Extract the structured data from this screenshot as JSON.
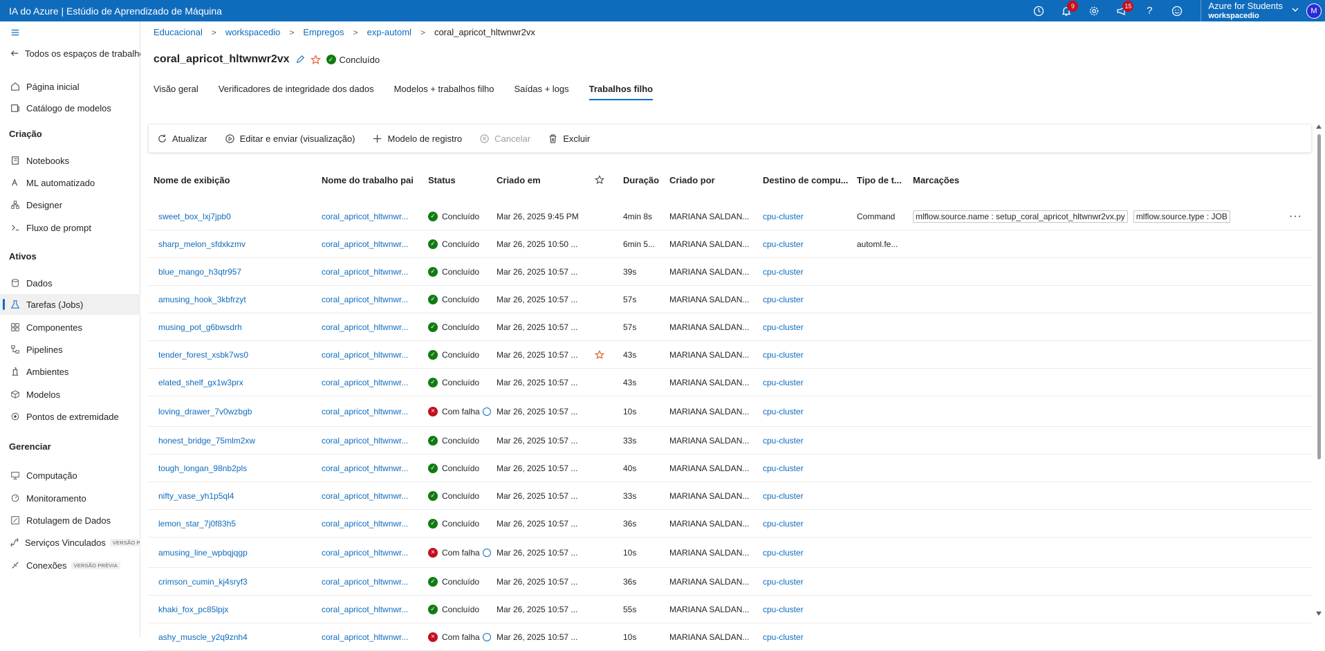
{
  "app": {
    "title": "IA do Azure | Estúdio de Aprendizado de Máquina"
  },
  "topbar": {
    "notifications_count": "9",
    "feedback_count": "15",
    "account_name": "Azure for Students",
    "workspace_name": "workspacedio",
    "avatar_initial": "M"
  },
  "sidebar": {
    "back_label": "Todos os espaços de trabalho",
    "items_top": [
      {
        "label": "Página inicial",
        "icon": "home-icon"
      },
      {
        "label": "Catálogo de modelos",
        "icon": "catalog-icon"
      }
    ],
    "section_creation": "Criação",
    "items_creation": [
      {
        "label": "Notebooks",
        "icon": "notebook-icon"
      },
      {
        "label": "ML automatizado",
        "icon": "automl-icon"
      },
      {
        "label": "Designer",
        "icon": "designer-icon"
      },
      {
        "label": "Fluxo de prompt",
        "icon": "prompt-icon"
      }
    ],
    "section_assets": "Ativos",
    "items_assets": [
      {
        "label": "Dados",
        "icon": "data-icon"
      },
      {
        "label": "Tarefas (Jobs)",
        "icon": "flask-icon"
      },
      {
        "label": "Componentes",
        "icon": "component-icon"
      },
      {
        "label": "Pipelines",
        "icon": "pipeline-icon"
      },
      {
        "label": "Ambientes",
        "icon": "environment-icon"
      },
      {
        "label": "Modelos",
        "icon": "model-icon"
      },
      {
        "label": "Pontos de extremidade",
        "icon": "endpoint-icon"
      }
    ],
    "section_manage": "Gerenciar",
    "items_manage": [
      {
        "label": "Computação",
        "icon": "compute-icon"
      },
      {
        "label": "Monitoramento",
        "icon": "monitor-icon"
      },
      {
        "label": "Rotulagem de Dados",
        "icon": "label-icon"
      },
      {
        "label": "Serviços Vinculados",
        "icon": "link-icon",
        "badge": "VERSÃO PRÉVIA"
      },
      {
        "label": "Conexões",
        "icon": "connection-icon",
        "badge": "VERSÃO PRÉVIA"
      }
    ]
  },
  "breadcrumb": [
    "Educacional",
    "workspacedio",
    "Empregos",
    "exp-automl",
    "coral_apricot_hltwnwr2vx"
  ],
  "page": {
    "title": "coral_apricot_hltwnwr2vx",
    "status": "Concluído"
  },
  "tabs": [
    "Visão geral",
    "Verificadores de integridade dos dados",
    "Modelos + trabalhos filho",
    "Saídas + logs",
    "Trabalhos filho"
  ],
  "toolbar": {
    "refresh": "Atualizar",
    "edit": "Editar e enviar (visualização)",
    "register": "Modelo de registro",
    "cancel": "Cancelar",
    "delete": "Excluir"
  },
  "table": {
    "columns": {
      "name": "Nome de exibição",
      "parent": "Nome do trabalho pai",
      "status": "Status",
      "created": "Criado em",
      "duration": "Duração",
      "created_by": "Criado por",
      "compute": "Destino de compu...",
      "type": "Tipo de t...",
      "tags": "Marcações"
    },
    "rows": [
      {
        "name": "sweet_box_lxj7jpb0",
        "parent": "coral_apricot_hltwnwr...",
        "status": "Concluído",
        "ok": true,
        "created": "Mar 26, 2025 9:45 PM",
        "fav": false,
        "duration": "4min 8s",
        "by": "MARIANA SALDAN...",
        "compute": "cpu-cluster",
        "type": "Command",
        "tags": [
          "mlflow.source.name : setup_coral_apricot_hltwnwr2vx.py",
          "mlflow.source.type : JOB"
        ]
      },
      {
        "name": "sharp_melon_sfdxkzmv",
        "parent": "coral_apricot_hltwnwr...",
        "status": "Concluído",
        "ok": true,
        "created": "Mar 26, 2025 10:50 ...",
        "fav": false,
        "duration": "6min 5...",
        "by": "MARIANA SALDAN...",
        "compute": "cpu-cluster",
        "type": "automl.fe...",
        "tags": []
      },
      {
        "name": "blue_mango_h3qtr957",
        "parent": "coral_apricot_hltwnwr...",
        "status": "Concluído",
        "ok": true,
        "created": "Mar 26, 2025 10:57 ...",
        "fav": false,
        "duration": "39s",
        "by": "MARIANA SALDAN...",
        "compute": "cpu-cluster",
        "type": "",
        "tags": []
      },
      {
        "name": "amusing_hook_3kbfrzyt",
        "parent": "coral_apricot_hltwnwr...",
        "status": "Concluído",
        "ok": true,
        "created": "Mar 26, 2025 10:57 ...",
        "fav": false,
        "duration": "57s",
        "by": "MARIANA SALDAN...",
        "compute": "cpu-cluster",
        "type": "",
        "tags": []
      },
      {
        "name": "musing_pot_g6bwsdrh",
        "parent": "coral_apricot_hltwnwr...",
        "status": "Concluído",
        "ok": true,
        "created": "Mar 26, 2025 10:57 ...",
        "fav": false,
        "duration": "57s",
        "by": "MARIANA SALDAN...",
        "compute": "cpu-cluster",
        "type": "",
        "tags": []
      },
      {
        "name": "tender_forest_xsbk7ws0",
        "parent": "coral_apricot_hltwnwr...",
        "status": "Concluído",
        "ok": true,
        "created": "Mar 26, 2025 10:57 ...",
        "fav": true,
        "duration": "43s",
        "by": "MARIANA SALDAN...",
        "compute": "cpu-cluster",
        "type": "",
        "tags": []
      },
      {
        "name": "elated_shelf_gx1w3prx",
        "parent": "coral_apricot_hltwnwr...",
        "status": "Concluído",
        "ok": true,
        "created": "Mar 26, 2025 10:57 ...",
        "fav": false,
        "duration": "43s",
        "by": "MARIANA SALDAN...",
        "compute": "cpu-cluster",
        "type": "",
        "tags": []
      },
      {
        "name": "loving_drawer_7v0wzbgb",
        "parent": "coral_apricot_hltwnwr...",
        "status": "Com falha",
        "ok": false,
        "created": "Mar 26, 2025 10:57 ...",
        "fav": false,
        "duration": "10s",
        "by": "MARIANA SALDAN...",
        "compute": "cpu-cluster",
        "type": "",
        "tags": []
      },
      {
        "name": "honest_bridge_75mlm2xw",
        "parent": "coral_apricot_hltwnwr...",
        "status": "Concluído",
        "ok": true,
        "created": "Mar 26, 2025 10:57 ...",
        "fav": false,
        "duration": "33s",
        "by": "MARIANA SALDAN...",
        "compute": "cpu-cluster",
        "type": "",
        "tags": []
      },
      {
        "name": "tough_longan_98nb2pls",
        "parent": "coral_apricot_hltwnwr...",
        "status": "Concluído",
        "ok": true,
        "created": "Mar 26, 2025 10:57 ...",
        "fav": false,
        "duration": "40s",
        "by": "MARIANA SALDAN...",
        "compute": "cpu-cluster",
        "type": "",
        "tags": []
      },
      {
        "name": "nifty_vase_yh1p5ql4",
        "parent": "coral_apricot_hltwnwr...",
        "status": "Concluído",
        "ok": true,
        "created": "Mar 26, 2025 10:57 ...",
        "fav": false,
        "duration": "33s",
        "by": "MARIANA SALDAN...",
        "compute": "cpu-cluster",
        "type": "",
        "tags": []
      },
      {
        "name": "lemon_star_7j0f83h5",
        "parent": "coral_apricot_hltwnwr...",
        "status": "Concluído",
        "ok": true,
        "created": "Mar 26, 2025 10:57 ...",
        "fav": false,
        "duration": "36s",
        "by": "MARIANA SALDAN...",
        "compute": "cpu-cluster",
        "type": "",
        "tags": []
      },
      {
        "name": "amusing_line_wpbqjqgp",
        "parent": "coral_apricot_hltwnwr...",
        "status": "Com falha",
        "ok": false,
        "created": "Mar 26, 2025 10:57 ...",
        "fav": false,
        "duration": "10s",
        "by": "MARIANA SALDAN...",
        "compute": "cpu-cluster",
        "type": "",
        "tags": []
      },
      {
        "name": "crimson_cumin_kj4sryf3",
        "parent": "coral_apricot_hltwnwr...",
        "status": "Concluído",
        "ok": true,
        "created": "Mar 26, 2025 10:57 ...",
        "fav": false,
        "duration": "36s",
        "by": "MARIANA SALDAN...",
        "compute": "cpu-cluster",
        "type": "",
        "tags": []
      },
      {
        "name": "khaki_fox_pc85lpjx",
        "parent": "coral_apricot_hltwnwr...",
        "status": "Concluído",
        "ok": true,
        "created": "Mar 26, 2025 10:57 ...",
        "fav": false,
        "duration": "55s",
        "by": "MARIANA SALDAN...",
        "compute": "cpu-cluster",
        "type": "",
        "tags": []
      },
      {
        "name": "ashy_muscle_y2q9znh4",
        "parent": "coral_apricot_hltwnwr...",
        "status": "Com falha",
        "ok": false,
        "created": "Mar 26, 2025 10:57 ...",
        "fav": false,
        "duration": "10s",
        "by": "MARIANA SALDAN...",
        "compute": "cpu-cluster",
        "type": "",
        "tags": []
      }
    ]
  },
  "colors": {
    "accent": "#0f6cbd",
    "success": "#107c10",
    "failure": "#c50f1f",
    "favorite": "#e3562b"
  }
}
